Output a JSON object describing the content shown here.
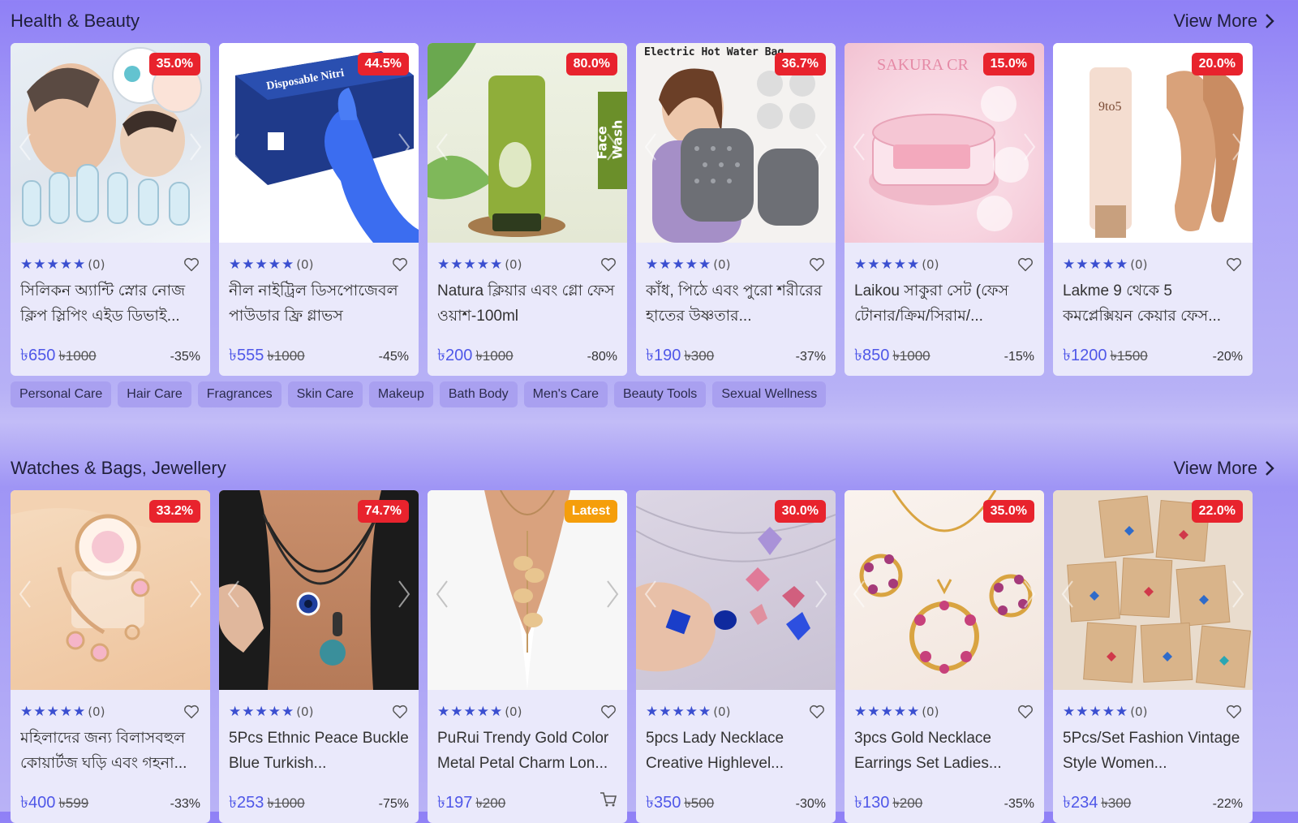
{
  "health": {
    "title": "Health & Beauty",
    "view_more": "View More",
    "products": [
      {
        "badge": "35.0%",
        "count": "(0)",
        "title": "সিলিকন অ্যান্টি স্নোর নোজ ক্লিপ স্লিপিং এইড ডিভাই...",
        "price": "৳650",
        "old_price": "৳1000",
        "discount": "-35%",
        "img_text": ""
      },
      {
        "badge": "44.5%",
        "count": "(0)",
        "title": "নীল নাইট্রিল ডিসপোজেবল পাউডার ফ্রি গ্লাভস",
        "price": "৳555",
        "old_price": "৳1000",
        "discount": "-45%",
        "img_text": "Disposable Nitri"
      },
      {
        "badge": "80.0%",
        "count": "(0)",
        "title": "Natura ক্লিয়ার এবং গ্লো ফেস ওয়াশ-100ml",
        "price": "৳200",
        "old_price": "৳1000",
        "discount": "-80%",
        "img_text": "Face Wash"
      },
      {
        "badge": "36.7%",
        "count": "(0)",
        "title": "কাঁধ, পিঠে এবং পুরো শরীরের হাতের উষ্ণতার...",
        "price": "৳190",
        "old_price": "৳300",
        "discount": "-37%",
        "img_text": "Electric Hot Water Bag"
      },
      {
        "badge": "15.0%",
        "count": "(0)",
        "title": "Laikou সাকুরা সেট (ফেস টোনার/ক্রিম/সিরাম/...",
        "price": "৳850",
        "old_price": "৳1000",
        "discount": "-15%",
        "img_text": "SAKURA CR"
      },
      {
        "badge": "20.0%",
        "count": "(0)",
        "title": "Lakme 9 থেকে 5 কমপ্লেক্সিয়ন কেয়ার ফেস...",
        "price": "৳1200",
        "old_price": "৳1500",
        "discount": "-20%",
        "img_text": "9to5"
      }
    ],
    "chips": [
      "Personal Care",
      "Hair Care",
      "Fragrances",
      "Skin Care",
      "Makeup",
      "Bath Body",
      "Men's Care",
      "Beauty Tools",
      "Sexual Wellness"
    ]
  },
  "watches": {
    "title": "Watches & Bags, Jewellery",
    "view_more": "View More",
    "products": [
      {
        "badge": "33.2%",
        "count": "(0)",
        "title": "মহিলাদের জন্য বিলাসবহুল কোয়ার্টজ ঘড়ি এবং গহনা...",
        "price": "৳400",
        "old_price": "৳599",
        "discount": "-33%"
      },
      {
        "badge": "74.7%",
        "count": "(0)",
        "title": "5Pcs Ethnic Peace Buckle Blue Turkish...",
        "price": "৳253",
        "old_price": "৳1000",
        "discount": "-75%"
      },
      {
        "badge": "Latest",
        "count": "(0)",
        "title": "PuRui Trendy Gold Color Metal Petal Charm Lon...",
        "price": "৳197",
        "old_price": "৳200",
        "discount": ""
      },
      {
        "badge": "30.0%",
        "count": "(0)",
        "title": "5pcs Lady Necklace Creative Highlevel...",
        "price": "৳350",
        "old_price": "৳500",
        "discount": "-30%"
      },
      {
        "badge": "35.0%",
        "count": "(0)",
        "title": "3pcs Gold Necklace Earrings Set Ladies...",
        "price": "৳130",
        "old_price": "৳200",
        "discount": "-35%"
      },
      {
        "badge": "22.0%",
        "count": "(0)",
        "title": "5Pcs/Set Fashion Vintage Style Women...",
        "price": "৳234",
        "old_price": "৳300",
        "discount": "-22%"
      }
    ]
  },
  "colors": {
    "badge": "#e8232d",
    "latest_badge": "#f59e0b",
    "price": "#4f57e8",
    "stars": "#3b4fd0"
  },
  "icons": {
    "rating": "star-icon",
    "wishlist": "heart-icon",
    "more": "chevron-right-icon",
    "cart": "cart-icon"
  }
}
